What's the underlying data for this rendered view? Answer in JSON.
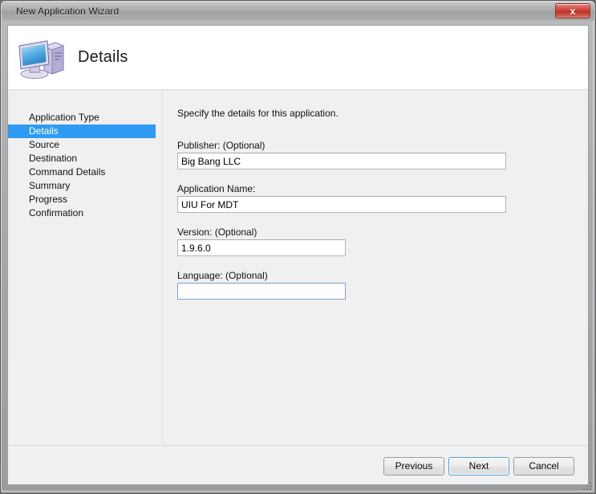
{
  "window": {
    "title": "New Application Wizard",
    "close_label": "x",
    "close_icon": "close-icon"
  },
  "banner": {
    "icon": "computer-icon",
    "page_title": "Details"
  },
  "sidebar": {
    "items": [
      {
        "label": "Application Type",
        "active": false
      },
      {
        "label": "Details",
        "active": true
      },
      {
        "label": "Source",
        "active": false
      },
      {
        "label": "Destination",
        "active": false
      },
      {
        "label": "Command Details",
        "active": false
      },
      {
        "label": "Summary",
        "active": false
      },
      {
        "label": "Progress",
        "active": false
      },
      {
        "label": "Confirmation",
        "active": false
      }
    ],
    "active_color": "#2f9bf2"
  },
  "content": {
    "intro": "Specify the details for this application.",
    "fields": [
      {
        "label": "Publisher: (Optional)",
        "value": "Big Bang LLC",
        "placeholder": "",
        "name": "publisher",
        "focused": false
      },
      {
        "label": "Application Name:",
        "value": "UIU For MDT",
        "placeholder": "",
        "name": "application-name",
        "focused": false
      },
      {
        "label": "Version: (Optional)",
        "value": "1.9.6.0",
        "placeholder": "",
        "name": "version",
        "focused": false
      },
      {
        "label": "Language: (Optional)",
        "value": "",
        "placeholder": "",
        "name": "language",
        "focused": true
      }
    ]
  },
  "footer": {
    "previous_label": "Previous",
    "next_label": "Next",
    "cancel_label": "Cancel"
  }
}
